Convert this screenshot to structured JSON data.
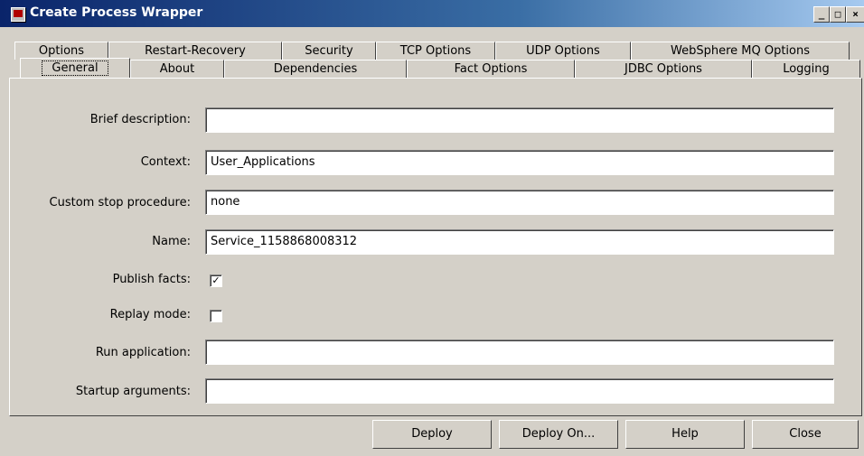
{
  "window": {
    "title": "Create Process Wrapper",
    "minimize_glyph": "_",
    "maximize_glyph": "□",
    "close_glyph": "×"
  },
  "tabs_back": [
    "Options",
    "Restart-Recovery",
    "Security",
    "TCP Options",
    "UDP Options",
    "WebSphere MQ Options"
  ],
  "tabs_front": [
    "General",
    "About",
    "Dependencies",
    "Fact Options",
    "JDBC Options",
    "Logging"
  ],
  "active_tab": "General",
  "form": {
    "brief_description": {
      "label": "Brief description:",
      "value": ""
    },
    "context": {
      "label": "Context:",
      "value": "User_Applications"
    },
    "custom_stop_procedure": {
      "label": "Custom stop procedure:",
      "value": "none"
    },
    "name": {
      "label": "Name:",
      "value": "Service_1158868008312"
    },
    "publish_facts": {
      "label": "Publish facts:",
      "checked": true,
      "glyph": "✓"
    },
    "replay_mode": {
      "label": "Replay mode:",
      "checked": false,
      "glyph": ""
    },
    "run_application": {
      "label": "Run application:",
      "value": ""
    },
    "startup_arguments": {
      "label": "Startup arguments:",
      "value": ""
    }
  },
  "buttons": {
    "deploy": "Deploy",
    "deploy_on": "Deploy On...",
    "help": "Help",
    "close": "Close"
  }
}
